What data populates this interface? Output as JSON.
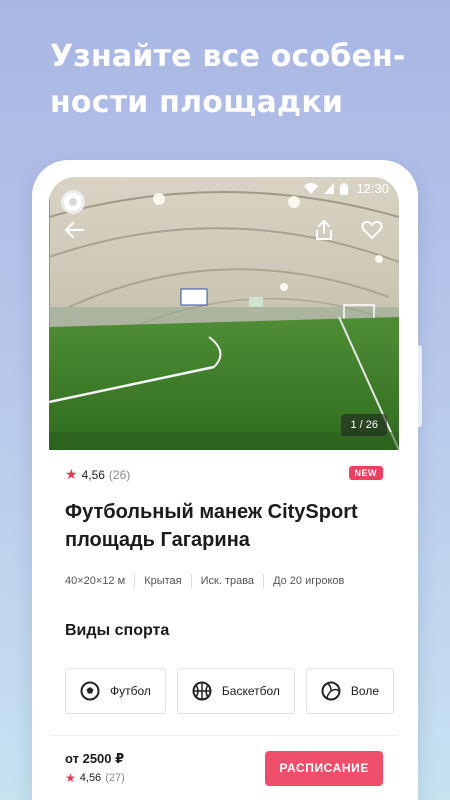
{
  "promo": {
    "line1": "Узнайте все особен-",
    "line2": "ности площадки"
  },
  "status_bar": {
    "time": "12:30",
    "icons": [
      "wifi-icon",
      "signal-icon",
      "battery-icon"
    ]
  },
  "hero": {
    "back_icon": "arrow-left-icon",
    "share_icon": "share-icon",
    "favorite_icon": "heart-icon",
    "photo_counter": "1 / 26"
  },
  "venue": {
    "rating": "4,56",
    "rating_count": "(26)",
    "badge": "NEW",
    "title_line1": "Футбольный манеж CitySport",
    "title_line2": "площадь Гагарина",
    "specs": [
      "40×20×12 м",
      "Крытая",
      "Иск. трава",
      "До 20 игроков"
    ]
  },
  "sports_section": {
    "title": "Виды спорта",
    "items": [
      {
        "label": "Футбол",
        "icon": "soccer-ball-icon"
      },
      {
        "label": "Баскетбол",
        "icon": "basketball-icon"
      },
      {
        "label": "Воле",
        "icon": "volleyball-icon"
      }
    ]
  },
  "bottom_bar": {
    "price": "от 2500 ₽",
    "rating": "4,56",
    "rating_count": "(27)",
    "schedule_button": "РАСПИСАНИЕ"
  },
  "colors": {
    "accent": "#ef4f6b",
    "badge": "#ee3f5f",
    "background_top": "#a9b6e4",
    "background_bottom": "#c6e3f0"
  }
}
